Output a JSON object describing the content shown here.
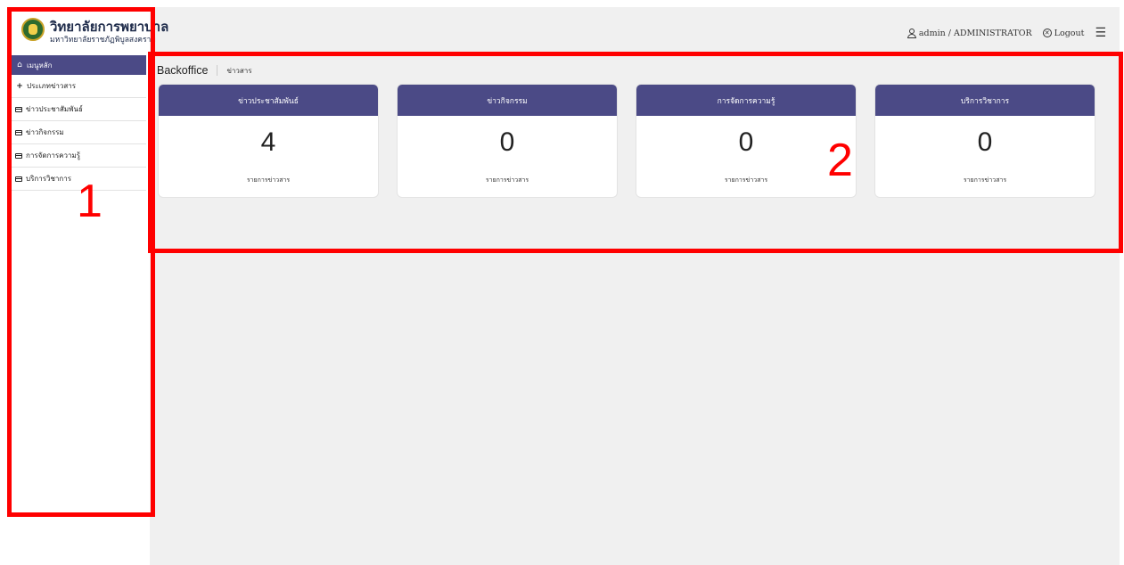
{
  "brand": {
    "title": "วิทยาลัยการพยาบาล",
    "subtitle": "มหาวิทยาลัยราชภัฏพิบูลสงคราม"
  },
  "topbar": {
    "user": "admin / ADMINISTRATOR",
    "logout": "Logout"
  },
  "breadcrumb": {
    "main": "Backoffice",
    "sub": "ข่าวสาร"
  },
  "sidebar": {
    "header": "เมนูหลัก",
    "items": [
      {
        "label": "ประเภทข่าวสาร",
        "icon": "plus-icon"
      },
      {
        "label": "ข่าวประชาสัมพันธ์",
        "icon": "card-icon"
      },
      {
        "label": "ข่าวกิจกรรม",
        "icon": "card-icon"
      },
      {
        "label": "การจัดการความรู้",
        "icon": "card-icon"
      },
      {
        "label": "บริการวิชาการ",
        "icon": "card-icon"
      }
    ]
  },
  "cards": [
    {
      "title": "ข่าวประชาสัมพันธ์",
      "count": "4",
      "caption": "รายการข่าวสาร"
    },
    {
      "title": "ข่าวกิจกรรม",
      "count": "0",
      "caption": "รายการข่าวสาร"
    },
    {
      "title": "การจัดการความรู้",
      "count": "0",
      "caption": "รายการข่าวสาร"
    },
    {
      "title": "บริการวิชาการ",
      "count": "0",
      "caption": "รายการข่าวสาร"
    }
  ],
  "annotations": {
    "label1": "1",
    "label2": "2",
    "color": "#ff0000"
  },
  "colors": {
    "accent": "#4b4a86",
    "background": "#f0f0f0"
  }
}
